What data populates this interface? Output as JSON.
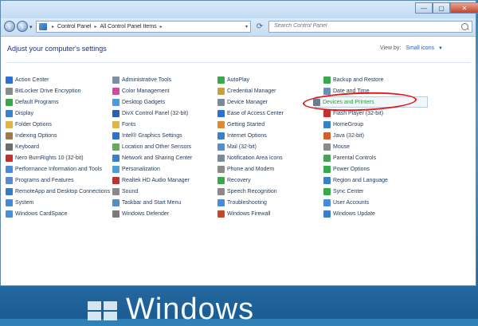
{
  "window": {
    "breadcrumb": [
      "Control Panel",
      "All Control Panel Items"
    ],
    "search_placeholder": "Search Control Panel",
    "caption": {
      "minimize": "—",
      "maximize": "▢",
      "close": "✕"
    }
  },
  "content": {
    "heading": "Adjust your computer's settings",
    "view_by_label": "View by:",
    "view_by_value": "Small icons"
  },
  "columns": [
    [
      {
        "label": "Action Center",
        "color": "#2f6fd0"
      },
      {
        "label": "BitLocker Drive Encryption",
        "color": "#8a8a8a"
      },
      {
        "label": "Default Programs",
        "color": "#3aa84a"
      },
      {
        "label": "Display",
        "color": "#3f7fcf"
      },
      {
        "label": "Folder Options",
        "color": "#e0b640"
      },
      {
        "label": "Indexing Options",
        "color": "#9a7c4a"
      },
      {
        "label": "Keyboard",
        "color": "#6d6d6d"
      },
      {
        "label": "Nero BurnRights 10 (32-bit)",
        "color": "#c23030"
      },
      {
        "label": "Performance Information and Tools",
        "color": "#4a8ad8"
      },
      {
        "label": "Programs and Features",
        "color": "#5a8ac8"
      },
      {
        "label": "RemoteApp and Desktop Connections",
        "color": "#3b7ac2"
      },
      {
        "label": "System",
        "color": "#4a88cf"
      },
      {
        "label": "Windows CardSpace",
        "color": "#4d8fd6"
      }
    ],
    [
      {
        "label": "Administrative Tools",
        "color": "#7c8fa8"
      },
      {
        "label": "Color Management",
        "color": "#d04aa0"
      },
      {
        "label": "Desktop Gadgets",
        "color": "#4a9ae0"
      },
      {
        "label": "DivX Control Panel (32-bit)",
        "color": "#2a60b0"
      },
      {
        "label": "Fonts",
        "color": "#e0b640"
      },
      {
        "label": "Intel® Graphics Settings",
        "color": "#2f6fd0"
      },
      {
        "label": "Location and Other Sensors",
        "color": "#6aa85a"
      },
      {
        "label": "Network and Sharing Center",
        "color": "#3a80c8"
      },
      {
        "label": "Personalization",
        "color": "#4aa0d8"
      },
      {
        "label": "Realtek HD Audio Manager",
        "color": "#c23030"
      },
      {
        "label": "Sound",
        "color": "#8a8a8a"
      },
      {
        "label": "Taskbar and Start Menu",
        "color": "#5a8ac8"
      },
      {
        "label": "Windows Defender",
        "color": "#7a7a7a"
      }
    ],
    [
      {
        "label": "AutoPlay",
        "color": "#3aa84a"
      },
      {
        "label": "Credential Manager",
        "color": "#c8a040"
      },
      {
        "label": "Device Manager",
        "color": "#7a8a9a"
      },
      {
        "label": "Ease of Access Center",
        "color": "#2f6fd0"
      },
      {
        "label": "Getting Started",
        "color": "#e08a30"
      },
      {
        "label": "Internet Options",
        "color": "#3a80c8"
      },
      {
        "label": "Mail (32-bit)",
        "color": "#5a8ac8"
      },
      {
        "label": "Notification Area Icons",
        "color": "#7a8a9a"
      },
      {
        "label": "Phone and Modem",
        "color": "#8a8a8a"
      },
      {
        "label": "Recovery",
        "color": "#3aa84a"
      },
      {
        "label": "Speech Recognition",
        "color": "#8a8a8a"
      },
      {
        "label": "Troubleshooting",
        "color": "#4a8ad8"
      },
      {
        "label": "Windows Firewall",
        "color": "#c24a2a"
      }
    ],
    [
      {
        "label": "Backup and Restore",
        "color": "#3aa84a"
      },
      {
        "label": "Date and Time",
        "color": "#6d8fb5"
      },
      {
        "label": "Devices and Printers",
        "color": "#6d7d8d",
        "highlighted": true
      },
      {
        "label": "Flash Player (32-bit)",
        "color": "#c23030"
      },
      {
        "label": "HomeGroup",
        "color": "#3a80c8"
      },
      {
        "label": "Java (32-bit)",
        "color": "#d06030"
      },
      {
        "label": "Mouse",
        "color": "#8a8a8a"
      },
      {
        "label": "Parental Controls",
        "color": "#4aa05a"
      },
      {
        "label": "Power Options",
        "color": "#3aa84a"
      },
      {
        "label": "Region and Language",
        "color": "#3a80c8"
      },
      {
        "label": "Sync Center",
        "color": "#3aa84a"
      },
      {
        "label": "User Accounts",
        "color": "#4a8ad8"
      },
      {
        "label": "Windows Update",
        "color": "#3a80c8"
      }
    ]
  ],
  "desktop": {
    "brand": "Windows"
  }
}
